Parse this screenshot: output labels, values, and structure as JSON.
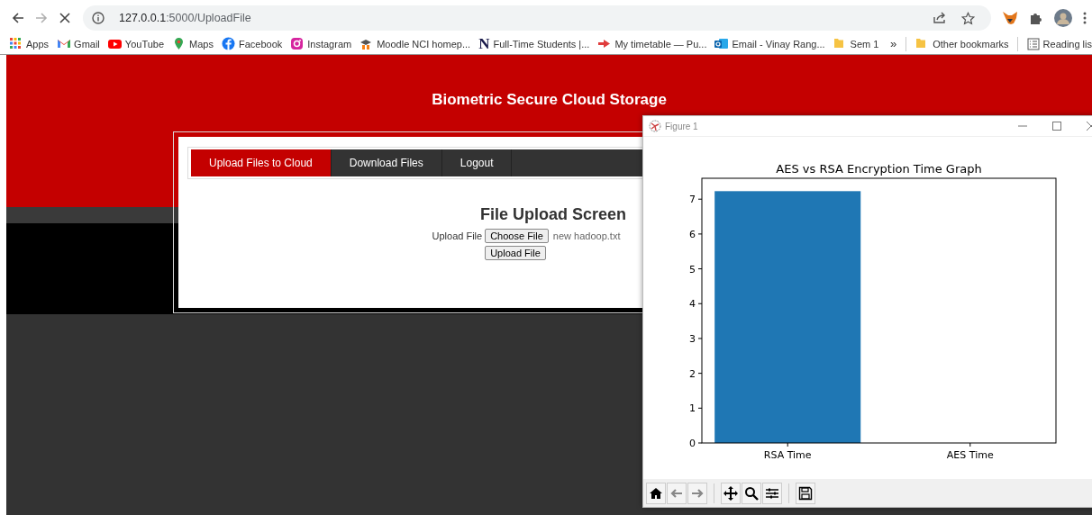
{
  "browser": {
    "nav_buttons": [
      {
        "kind": "back",
        "disabled": false
      },
      {
        "kind": "forward",
        "disabled": true
      },
      {
        "kind": "stop",
        "disabled": false
      }
    ],
    "address": {
      "host": "127.0.0.1",
      "path": ":5000/UploadFile"
    },
    "bookmarks": [
      {
        "label": "Apps"
      },
      {
        "label": "Gmail"
      },
      {
        "label": "YouTube"
      },
      {
        "label": "Maps"
      },
      {
        "label": "Facebook"
      },
      {
        "label": "Instagram"
      },
      {
        "label": "Moodle NCI homep..."
      },
      {
        "label": "Full-Time Students |...",
        "logo_text": "N"
      },
      {
        "label": "My timetable — Pu..."
      },
      {
        "label": "Email - Vinay Rang..."
      },
      {
        "label": "Sem 1"
      }
    ],
    "more_bookmarks": "»",
    "other_bookmarks": "Other bookmarks",
    "reading_list": "Reading lis"
  },
  "page": {
    "title": "Biometric Secure Cloud Storage",
    "tabs": [
      {
        "label": "Upload Files to Cloud",
        "selected": true
      },
      {
        "label": "Download Files",
        "selected": false
      },
      {
        "label": "Logout",
        "selected": false
      }
    ],
    "heading": "File Upload Screen",
    "file_label": "Upload File",
    "choose_button": "Choose File",
    "file_name": "new hadoop.txt",
    "upload_button": "Upload File"
  },
  "figure_window": {
    "title": "Figure 1",
    "chart_data": {
      "type": "bar",
      "title": "AES vs RSA Encryption Time Graph",
      "categories": [
        "RSA Time",
        "AES Time"
      ],
      "values": [
        7.23,
        0
      ],
      "ylim": [
        0,
        7.6
      ],
      "yticks": [
        0,
        1,
        2,
        3,
        4,
        5,
        6,
        7
      ]
    }
  }
}
